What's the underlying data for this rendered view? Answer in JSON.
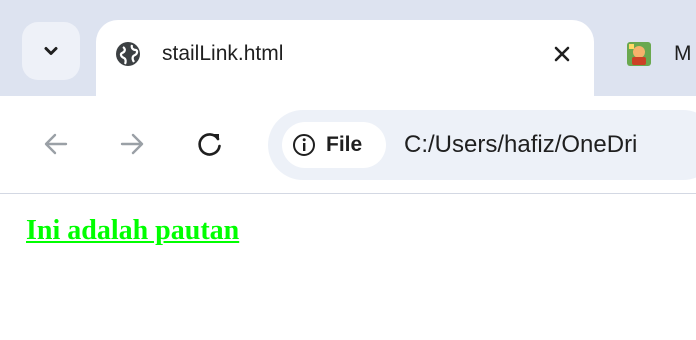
{
  "tabs": {
    "active": {
      "title": "stailLink.html",
      "icon": "globe-icon"
    },
    "inactive": {
      "title": "M",
      "icon": "site-favicon"
    }
  },
  "toolbar": {
    "back_icon": "arrow-left-icon",
    "forward_icon": "arrow-right-icon",
    "reload_icon": "reload-icon",
    "site_info_label": "File",
    "url": "C:/Users/hafiz/OneDri"
  },
  "page": {
    "link_text": "Ini adalah pautan",
    "link_color": "#00ff00"
  },
  "colors": {
    "titlebar": "#dde3f0",
    "omnibox": "#edf1f8"
  }
}
